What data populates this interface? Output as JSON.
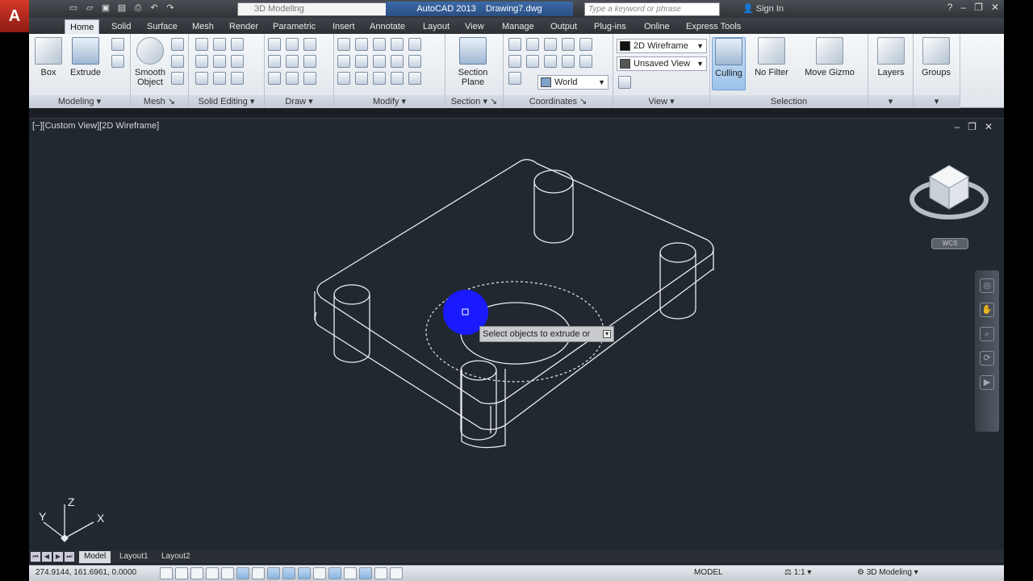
{
  "title": {
    "app": "AutoCAD 2013",
    "drawing": "Drawing7.dwg",
    "workspace": "3D Modeling",
    "search_placeholder": "Type a keyword or phrase",
    "signin": "Sign In"
  },
  "tabs": [
    "Home",
    "Solid",
    "Surface",
    "Mesh",
    "Render",
    "Parametric",
    "Insert",
    "Annotate",
    "Layout",
    "View",
    "Manage",
    "Output",
    "Plug-ins",
    "Online",
    "Express Tools"
  ],
  "ribbon": {
    "box": "Box",
    "extrude": "Extrude",
    "smooth_object_1": "Smooth",
    "smooth_object_2": "Object",
    "section_plane_1": "Section",
    "section_plane_2": "Plane",
    "visual_style": "2D Wireframe",
    "named_view": "Unsaved View",
    "ucs": "World",
    "culling": "Culling",
    "no_filter": "No Filter",
    "move_gizmo": "Move Gizmo",
    "layers": "Layers",
    "groups": "Groups",
    "panels": {
      "modeling": "Modeling",
      "mesh": "Mesh",
      "solid_editing": "Solid Editing",
      "draw": "Draw",
      "modify": "Modify",
      "section": "Section",
      "coordinates": "Coordinates",
      "view": "View",
      "selection": "Selection"
    }
  },
  "viewport": {
    "label": "[−][Custom View][2D Wireframe]",
    "tooltip": "Select objects to extrude or",
    "wcs": "WCS",
    "axis_x": "X",
    "axis_y": "Y",
    "axis_z": "Z"
  },
  "layout_tabs": [
    "Model",
    "Layout1",
    "Layout2"
  ],
  "status": {
    "coords": "274.9144, 161.6961, 0.0000",
    "model": "MODEL",
    "scale": "1:1",
    "workspace": "3D Modeling"
  },
  "colors": {
    "viewport_bg": "#212830",
    "wire": "#e9ecef",
    "cursor_blue": "#1a1aff"
  }
}
